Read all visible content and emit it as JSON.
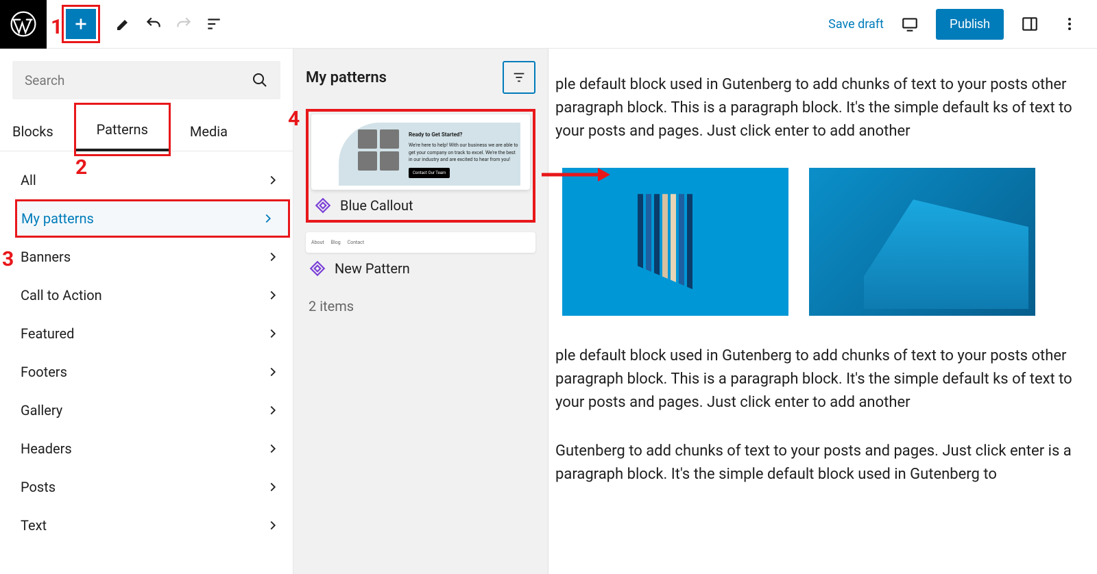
{
  "topbar": {
    "save_draft": "Save draft",
    "publish": "Publish"
  },
  "search": {
    "placeholder": "Search"
  },
  "tabs": {
    "blocks": "Blocks",
    "patterns": "Patterns",
    "media": "Media"
  },
  "categories": [
    "All",
    "My patterns",
    "Banners",
    "Call to Action",
    "Featured",
    "Footers",
    "Gallery",
    "Headers",
    "Posts",
    "Text"
  ],
  "patterns_panel": {
    "title": "My patterns",
    "items": [
      {
        "name": "Blue Callout",
        "preview_heading": "Ready to Get Started?",
        "preview_body": "We're here to help! With our business we are able to get your company on track to excel. We're the best in our industry and are excited to hear from you!",
        "preview_cta": "Contact Our Team"
      },
      {
        "name": "New Pattern",
        "nav": [
          "About",
          "Blog",
          "Contact"
        ]
      }
    ],
    "count": "2 items"
  },
  "content": {
    "p1": "ple default block used in Gutenberg to add chunks of text to your posts other paragraph block. This is a paragraph block. It's the simple default ks of text to your posts and pages. Just click enter to add another",
    "p2": "ple default block used in Gutenberg to add chunks of text to your posts other paragraph block. This is a paragraph block. It's the simple default ks of text to your posts and pages. Just click enter to add another",
    "p3": "Gutenberg to add chunks of text to your posts and pages. Just click enter is a paragraph block. It's the simple default block used in Gutenberg to"
  },
  "annotations": {
    "a1": "1",
    "a2": "2",
    "a3": "3",
    "a4": "4"
  }
}
